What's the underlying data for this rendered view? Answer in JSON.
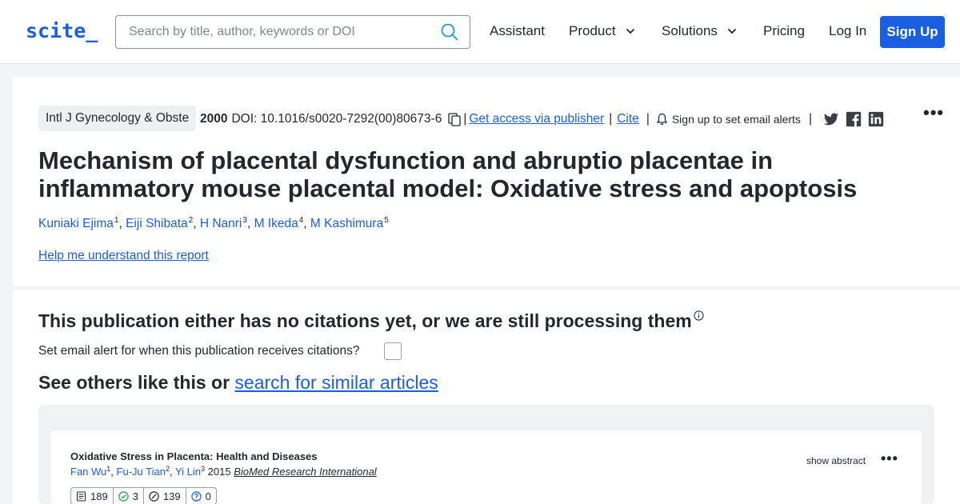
{
  "header": {
    "logo": "scite_",
    "search_placeholder": "Search by title, author, keywords or DOI",
    "nav": {
      "assistant": "Assistant",
      "product": "Product",
      "solutions": "Solutions",
      "pricing": "Pricing",
      "login": "Log In",
      "signup": "Sign Up"
    }
  },
  "paper": {
    "journal": "Intl J Gynecology & Obste",
    "year": "2000",
    "doi": "DOI: 10.1016/s0020-7292(00)80673-6",
    "access_link": "Get access via publisher",
    "cite_link": "Cite",
    "alert_text": "Sign up to set email alerts",
    "title": "Mechanism of placental dysfunction and abruptio placentae in inflammatory mouse placental model: Oxidative stress and apoptosis",
    "authors": [
      {
        "name": "Kuniaki Ejima",
        "sup": "1"
      },
      {
        "name": "Eiji Shibata",
        "sup": "2"
      },
      {
        "name": "H Nanri",
        "sup": "3"
      },
      {
        "name": "M Ikeda",
        "sup": "4"
      },
      {
        "name": "M Kashimura",
        "sup": "5"
      }
    ],
    "help_link": "Help me understand this report"
  },
  "citations": {
    "no_citations": "This publication either has no citations yet, or we are still processing them",
    "email_alert": "Set email alert for when this publication receives citations?",
    "see_others": "See others like this or",
    "search_similar": "search for similar articles"
  },
  "similar": [
    {
      "title": "Oxidative Stress in Placenta: Health and Diseases",
      "authors": [
        {
          "name": "Fan Wu",
          "sup": "1"
        },
        {
          "name": "Fu-Ju Tian",
          "sup": "2"
        },
        {
          "name": "Yi Lin",
          "sup": "3"
        }
      ],
      "year": "2015",
      "journal": "BioMed Research International",
      "show_abstract": "show abstract",
      "stats": {
        "total": "189",
        "supporting": "3",
        "mentioning": "139",
        "contrasting": "0"
      }
    }
  ],
  "colors": {
    "accent": "#1a5fe0",
    "supporting": "#2e9e4b",
    "contrasting": "#1a5fe0"
  }
}
